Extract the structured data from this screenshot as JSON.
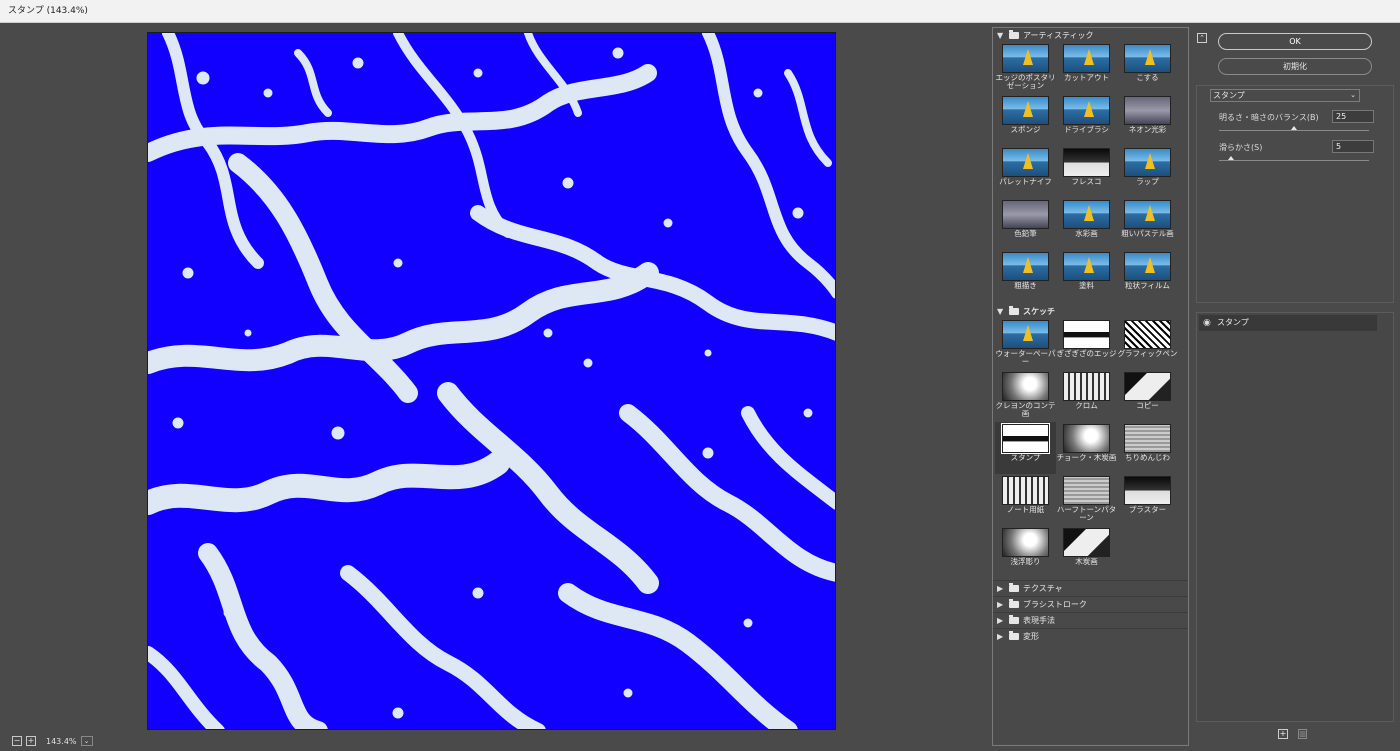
{
  "window": {
    "title": "スタンプ (143.4%)"
  },
  "preview": {
    "zoom": "143.4%",
    "fill_color": "#1100ff",
    "pattern_color": "#dde8f4"
  },
  "gallery": {
    "artistic": {
      "name": "アーティスティック",
      "items": [
        "エッジのポスタリゼーション",
        "カットアウト",
        "こする",
        "スポンジ",
        "ドライブラシ",
        "ネオン光彩",
        "パレットナイフ",
        "フレスコ",
        "ラップ",
        "色鉛筆",
        "水彩画",
        "粗いパステル画",
        "粗描き",
        "塗料",
        "粒状フィルム"
      ]
    },
    "sketch": {
      "name": "スケッチ",
      "items": [
        "ウォーターペーパー",
        "ぎざぎざのエッジ",
        "グラフィックペン",
        "クレヨンのコンテ画",
        "クロム",
        "コピー",
        "スタンプ",
        "チョーク・木炭画",
        "ちりめんじわ",
        "ノート用紙",
        "ハーフトーンパターン",
        "プラスター",
        "浅浮彫り",
        "木炭画"
      ],
      "selected": "スタンプ"
    },
    "collapsed": [
      "テクスチャ",
      "ブラシストローク",
      "表現手法",
      "変形"
    ]
  },
  "panel": {
    "ok_label": "OK",
    "reset_label": "初期化",
    "filter_name": "スタンプ",
    "params": [
      {
        "label": "明るさ・暗さのバランス(B)",
        "value": "25"
      },
      {
        "label": "滑らかさ(S)",
        "value": "5"
      }
    ],
    "layer_name": "スタンプ"
  }
}
